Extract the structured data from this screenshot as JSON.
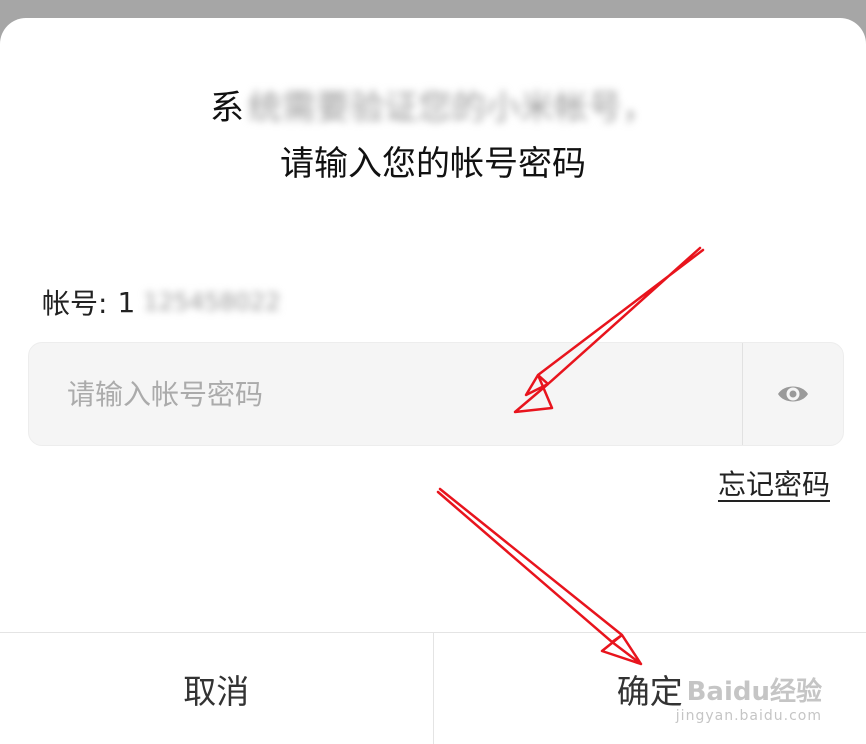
{
  "dialog": {
    "title_line1_visible": "系",
    "title_line1_redacted": "统需要验证您的小米帐号，",
    "title_line2": "请输入您的帐号密码"
  },
  "account": {
    "label": "帐号:",
    "value_prefix": "1",
    "value_redacted": "125458022"
  },
  "password": {
    "placeholder": "请输入帐号密码",
    "value": "",
    "toggle_icon": "eye-icon"
  },
  "forgot_label": "忘记密码",
  "buttons": {
    "cancel_label": "取消",
    "confirm_label": "确定"
  },
  "watermark": {
    "main": "Baidu经验",
    "sub": "jingyan.baidu.com"
  },
  "colors": {
    "overlay": "#a6a6a6",
    "annotation_arrow": "#e8141d"
  }
}
